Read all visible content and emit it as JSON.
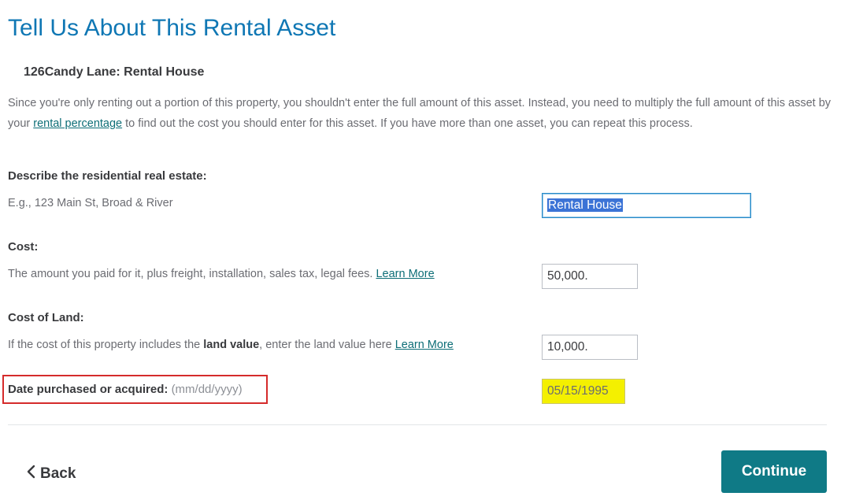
{
  "page": {
    "title": "Tell Us About This Rental Asset",
    "asset_name": "126Candy Lane: Rental House",
    "intro_part1": "Since you're only renting out a portion of this property, you shouldn't enter the full amount of this asset. Instead, you need to multiply the full amount of this asset by your ",
    "intro_link": "rental percentage",
    "intro_part2": " to find out the cost you should enter for this asset. If you have more than one asset, you can repeat this process."
  },
  "fields": {
    "description": {
      "label": "Describe the residential real estate:",
      "help": "E.g., 123 Main St, Broad & River",
      "value": "Rental House"
    },
    "cost": {
      "label": "Cost:",
      "help": "The amount you paid for it, plus freight, installation, sales tax, legal fees.",
      "link": "Learn More",
      "value": "50,000."
    },
    "land": {
      "label": "Cost of Land:",
      "help_part1": "If the cost of this property includes the ",
      "help_bold": "land value",
      "help_part2": ", enter the land value here",
      "link": "Learn More",
      "value": "10,000."
    },
    "date": {
      "label": "Date purchased or acquired:",
      "hint": "(mm/dd/yyyy)",
      "value": "05/15/1995"
    }
  },
  "footer": {
    "back_label": "Back",
    "continue_label": "Continue"
  },
  "colors": {
    "title": "#0f77b4",
    "link": "#0d6e77",
    "continue_bg": "#0f7a86",
    "date_highlight": "#f4f000",
    "annotation_box": "#d52b2b"
  }
}
